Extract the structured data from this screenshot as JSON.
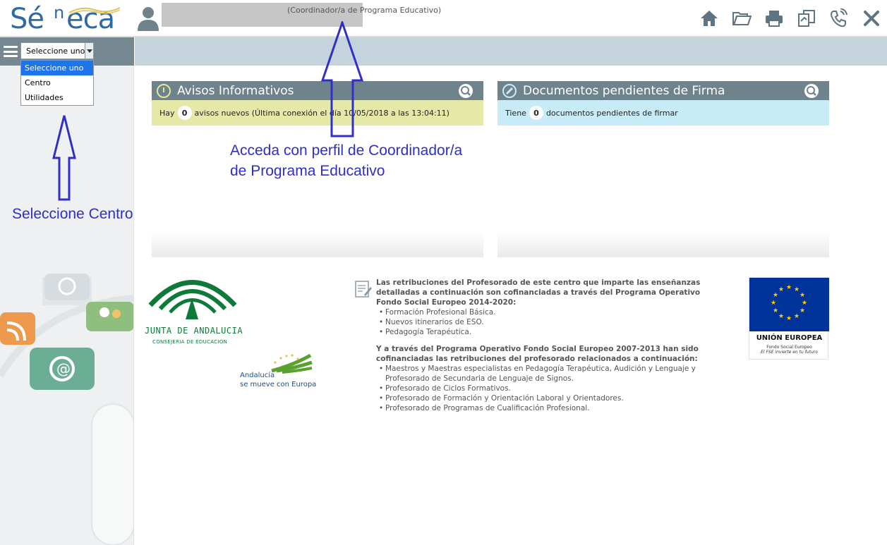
{
  "app": {
    "logo_text_se": "Sé",
    "logo_text_n": "n",
    "logo_text_eca": "eca",
    "brand_color": "#2e6aa5"
  },
  "header": {
    "user_role": "(Coordinador/a de Programa Educativo)",
    "toolbar": [
      {
        "name": "home-icon",
        "label": "Inicio"
      },
      {
        "name": "folder-open-icon",
        "label": "Abrir"
      },
      {
        "name": "print-icon",
        "label": "Imprimir"
      },
      {
        "name": "copy-icon",
        "label": "Copiar"
      },
      {
        "name": "phone-icon",
        "label": "Contacto"
      },
      {
        "name": "close-icon",
        "label": "Salir"
      }
    ]
  },
  "nav": {
    "select_value": "Seleccione uno",
    "options": [
      "Seleccione uno",
      "Centro",
      "Utilidades"
    ],
    "selected_index": 0
  },
  "avisos": {
    "title": "Avisos Informativos",
    "prefix": "Hay",
    "count": "0",
    "suffix": "avisos nuevos (Última conexión el día 10/05/2018 a las 13:04:11)"
  },
  "documentos": {
    "title": "Documentos pendientes de Firma",
    "prefix": "Tiene",
    "count": "0",
    "suffix": "documentos pendientes de firmar"
  },
  "footer": {
    "junta_title": "JUNTA DE ANDALUCIA",
    "junta_subtitle": "CONSEJERIA DE EDUCACION",
    "andalucia_line1": "Andalucía",
    "andalucia_line2": "se mueve con Europa",
    "fse_intro": "Las retribuciones del Profesorado de este centro que imparte las enseñanzas detalladas a continuación son cofinanciadas a través del Programa Operativo Fondo Social Europeo 2014-2020:",
    "fse_list1": [
      "Formación Profesional Básica.",
      "Nuevos itinerarios de ESO.",
      "Pedagogía Terapéutica."
    ],
    "fse_intro2": "Y a través del Programa Operativo Fondo Social Europeo 2007-2013 han sido cofinanciadas las retribuciones del profesorado relacionados a continuación:",
    "fse_list2": [
      "Maestros y Maestras especialistas en Pedagogía Terapéutica, Audición y Lenguaje y Profesorado de Secundaria de Lenguaje de Signos.",
      "Profesorado de Ciclos Formativos.",
      "Profesorado de Formación y Orientación Laboral y Orientadores.",
      "Profesorado de Programas de Cualificación Profesional."
    ],
    "eu_title": "UNIÓN EUROPEA",
    "eu_sub1": "Fondo Social Europeo",
    "eu_sub2": "El FSE invierte en tu futuro"
  },
  "annotations": {
    "perfil_line1": "Acceda con perfil de Coordinador/a",
    "perfil_line2": "de Programa Educativo",
    "centro": "Seleccione Centro"
  }
}
